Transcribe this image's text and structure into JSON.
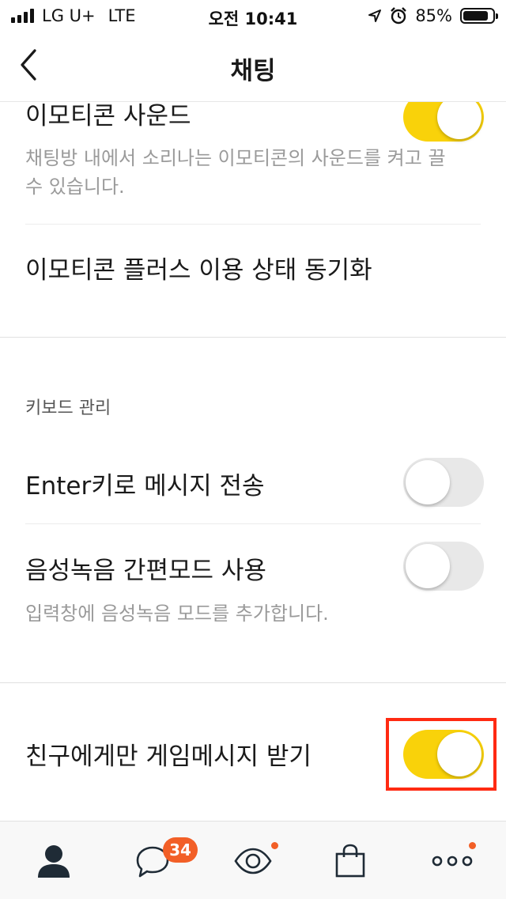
{
  "status_bar": {
    "carrier": "LG U+",
    "network": "LTE",
    "time": "오전 10:41",
    "battery": "85%",
    "battery_level": 0.85
  },
  "nav": {
    "title": "채팅",
    "back_icon": "chevron-left-icon"
  },
  "settings": {
    "emoticon_sound": {
      "label": "이모티콘 사운드",
      "description": "채팅방 내에서 소리나는 이모티콘의 사운드를 켜고 끌 수 있습니다.",
      "enabled": true
    },
    "emoticon_plus_sync": {
      "label": "이모티콘 플러스 이용 상태 동기화"
    },
    "keyboard_section": {
      "header": "키보드 관리",
      "enter_to_send": {
        "label": "Enter키로 메시지 전송",
        "enabled": false
      },
      "voice_simple_mode": {
        "label": "음성녹음 간편모드 사용",
        "description": "입력창에 음성녹음 모드를 추가합니다.",
        "enabled": false
      }
    },
    "friends_game_messages": {
      "label": "친구에게만 게임메시지 받기",
      "enabled": true
    }
  },
  "tab_bar": {
    "tabs": [
      {
        "icon": "person-icon",
        "name": "friends"
      },
      {
        "icon": "chat-bubble-icon",
        "name": "chats",
        "badge": "34"
      },
      {
        "icon": "eye-icon",
        "name": "view",
        "dot": true
      },
      {
        "icon": "shopping-bag-icon",
        "name": "shopping"
      },
      {
        "icon": "more-icon",
        "name": "more",
        "dot": true
      }
    ]
  },
  "colors": {
    "accent_yellow": "#f9d20a",
    "badge_orange": "#f25f27",
    "highlight_red": "#ff2a12"
  }
}
